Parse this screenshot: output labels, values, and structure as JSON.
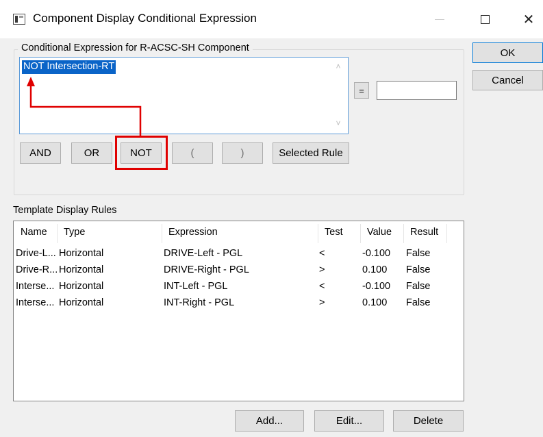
{
  "window": {
    "title": "Component Display Conditional Expression",
    "close_glyph": "✕"
  },
  "expression_group": {
    "label": "Conditional Expression for R-ACSC-SH Component",
    "expression_text": "NOT Intersection-RT",
    "equals_label": "=",
    "value": ""
  },
  "operators": {
    "and": "AND",
    "or": "OR",
    "not": "NOT",
    "lparen": "(",
    "rparen": ")",
    "selected_rule": "Selected Rule"
  },
  "dialog_buttons": {
    "ok": "OK",
    "cancel": "Cancel"
  },
  "template_rules": {
    "label": "Template Display Rules",
    "columns": [
      "Name",
      "Type",
      "Expression",
      "Test",
      "Value",
      "Result"
    ],
    "rows": [
      [
        "Drive-L...",
        "Horizontal",
        "DRIVE-Left - PGL",
        "<",
        "-0.100",
        "False"
      ],
      [
        "Drive-R...",
        "Horizontal",
        "DRIVE-Right - PGL",
        ">",
        "0.100",
        "False"
      ],
      [
        "Interse...",
        "Horizontal",
        "INT-Left - PGL",
        "<",
        "-0.100",
        "False"
      ],
      [
        "Interse...",
        "Horizontal",
        "INT-Right - PGL",
        ">",
        "0.100",
        "False"
      ]
    ]
  },
  "list_buttons": {
    "add": "Add...",
    "edit": "Edit...",
    "delete": "Delete"
  },
  "annotation": {
    "highlight_color": "#e00000"
  }
}
